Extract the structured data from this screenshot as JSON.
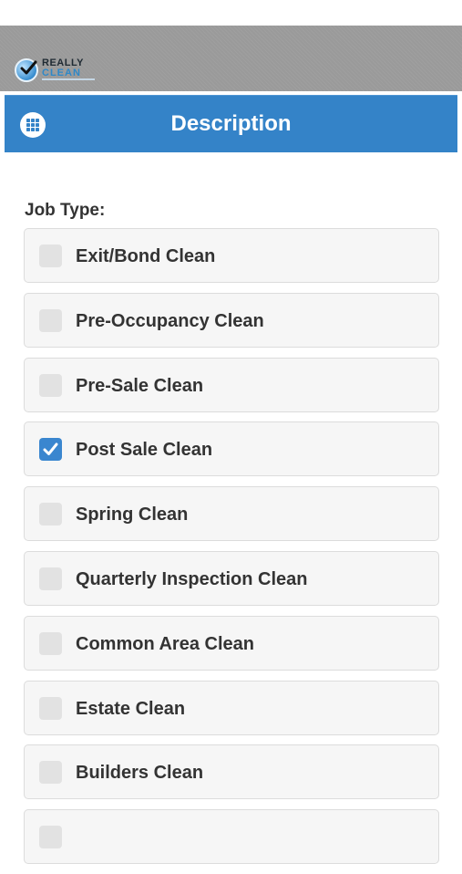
{
  "logo": {
    "word": "REALLY",
    "sub": "CLEAN"
  },
  "header": {
    "title": "Description",
    "menu_icon": "grid-icon"
  },
  "form": {
    "job_type_label": "Job Type:",
    "options": [
      {
        "label": "Exit/Bond Clean",
        "checked": false
      },
      {
        "label": "Pre-Occupancy Clean",
        "checked": false
      },
      {
        "label": "Pre-Sale Clean",
        "checked": false
      },
      {
        "label": "Post Sale Clean",
        "checked": true
      },
      {
        "label": "Spring Clean",
        "checked": false
      },
      {
        "label": "Quarterly Inspection Clean",
        "checked": false
      },
      {
        "label": "Common Area Clean",
        "checked": false
      },
      {
        "label": "Estate Clean",
        "checked": false
      },
      {
        "label": "Builders Clean",
        "checked": false
      },
      {
        "label": "",
        "checked": false
      }
    ]
  },
  "colors": {
    "header_bg": "#3483c8",
    "checkbox_checked": "#3a86cf",
    "brand_bar": "#9a9a9a"
  }
}
